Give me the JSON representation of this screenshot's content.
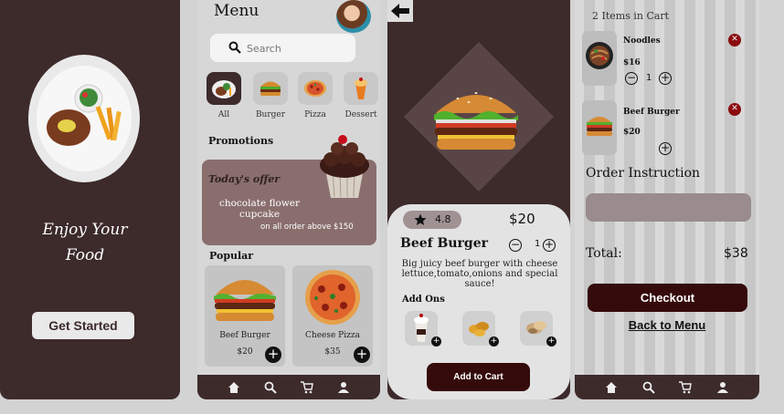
{
  "splash": {
    "tagline_line1": "Enjoy Your",
    "tagline_line2": "Food",
    "cta": "Get Started"
  },
  "menu": {
    "title": "Menu",
    "search_placeholder": "Search",
    "categories": [
      {
        "label": "All"
      },
      {
        "label": "Burger"
      },
      {
        "label": "Pizza"
      },
      {
        "label": "Dessert"
      }
    ],
    "promotions_title": "Promotions",
    "offer_title": "Today's offer",
    "offer_item": "chocolate flower cupcake",
    "offer_condition": "on all order above $150",
    "popular_title": "Popular",
    "popular": [
      {
        "name": "Beef Burger",
        "price": "$20"
      },
      {
        "name": "Cheese Pizza",
        "price": "$35"
      }
    ]
  },
  "detail": {
    "rating": "4.8",
    "price": "$20",
    "name": "Beef Burger",
    "quantity": "1",
    "description": "Big juicy beef burger with cheese lettuce,tomato,onions and special sauce!",
    "addons_title": "Add Ons",
    "add_to_cart": "Add to Cart"
  },
  "cart": {
    "count": "2 Items in Cart",
    "items": [
      {
        "name": "Noodles",
        "price": "$16",
        "quantity": "1"
      },
      {
        "name": "Beef Burger",
        "price": "$20"
      }
    ],
    "order_instruction": "Order Instruction",
    "total_label": "Total:",
    "total_value": "$38",
    "checkout": "Checkout",
    "back": "Back to Menu"
  },
  "colors": {
    "dark_brown": "#3d2a2b",
    "maroon": "#350a0b",
    "promo": "#8a6e6e",
    "remove_red": "#8b0c0f"
  },
  "icons": [
    "home-icon",
    "search-icon",
    "cart-icon",
    "user-icon",
    "back-arrow-icon",
    "star-icon",
    "plus-icon",
    "minus-icon",
    "close-icon"
  ]
}
